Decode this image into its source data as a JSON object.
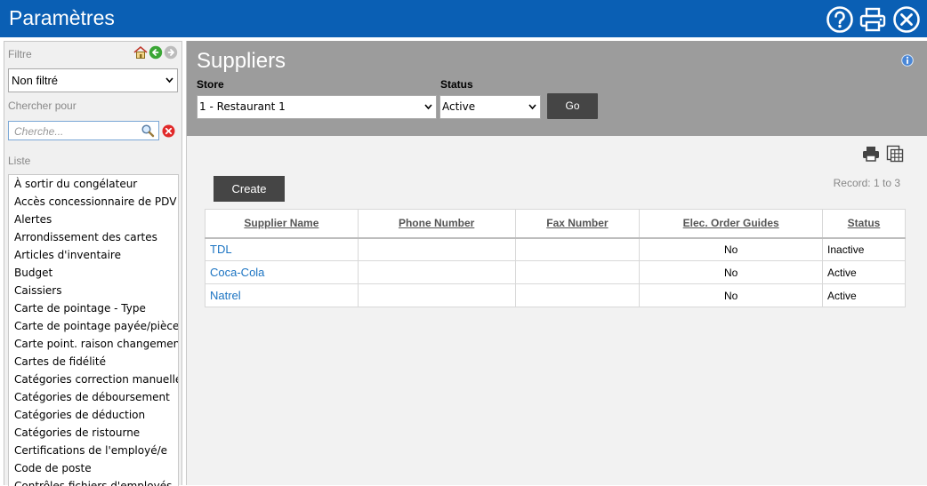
{
  "window": {
    "title": "Paramètres"
  },
  "sidebar": {
    "filter_label": "Filtre",
    "filter_value": "Non filtré",
    "search_label": "Chercher pour",
    "search_placeholder": "Cherche...",
    "list_label": "Liste",
    "items": [
      "À sortir du congélateur",
      "Accès concessionnaire de PDV",
      "Alertes",
      "Arrondissement des cartes",
      "Articles d'inventaire",
      "Budget",
      "Caissiers",
      "Carte de pointage - Type",
      "Carte de pointage payée/pièce",
      "Carte point. raison changement",
      "Cartes de fidélité",
      "Catégories correction manuelle",
      "Catégories de déboursement",
      "Catégories de déduction",
      "Catégories de ristourne",
      "Certifications de l'employé/e",
      "Code de poste",
      "Contrôles fichiers d'employés"
    ]
  },
  "main": {
    "title": "Suppliers",
    "store_label": "Store",
    "store_value": "1 - Restaurant 1",
    "status_label": "Status",
    "status_value": "Active",
    "go_label": "Go",
    "create_label": "Create",
    "record_text": "Record: 1 to 3",
    "table": {
      "columns": [
        "Supplier Name",
        "Phone Number",
        "Fax Number",
        "Elec. Order Guides",
        "Status"
      ],
      "rows": [
        {
          "name": "TDL",
          "phone": "",
          "fax": "",
          "guides": "No",
          "status": "Inactive"
        },
        {
          "name": "Coca-Cola",
          "phone": "",
          "fax": "",
          "guides": "No",
          "status": "Active"
        },
        {
          "name": "Natrel",
          "phone": "",
          "fax": "",
          "guides": "No",
          "status": "Active"
        }
      ]
    }
  },
  "colors": {
    "titlebar": "#0a5fb4",
    "header_gray": "#9c9c9c",
    "button_dark": "#454545",
    "link": "#1a73c2"
  }
}
